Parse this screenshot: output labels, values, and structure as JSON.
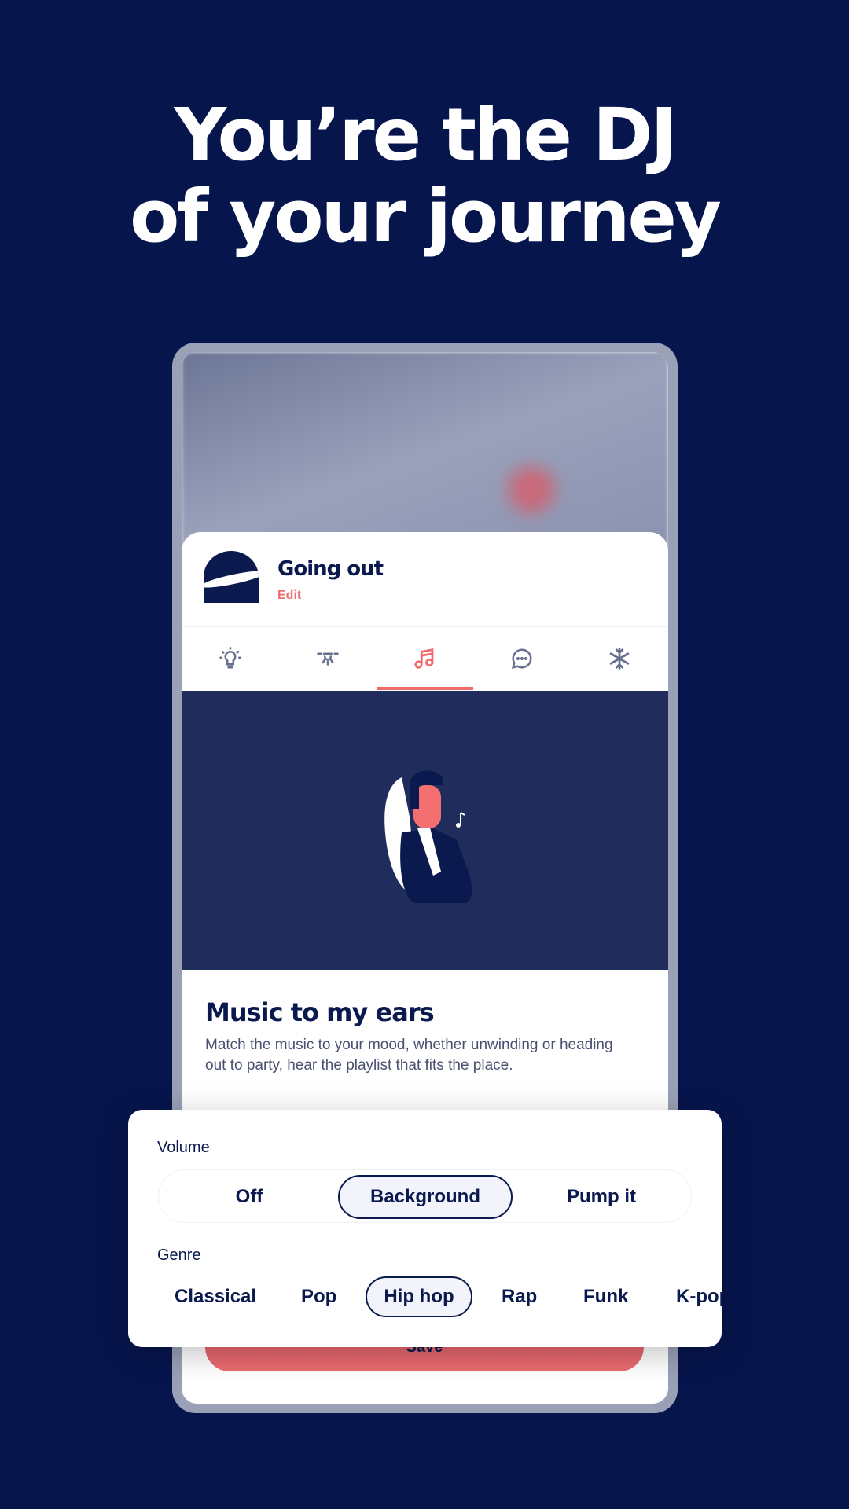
{
  "headline": {
    "line1": "You’re the DJ",
    "line2": "of your journey"
  },
  "profile": {
    "title": "Going out",
    "edit_label": "Edit"
  },
  "tabs": [
    {
      "icon": "lightbulb-icon",
      "active": false
    },
    {
      "icon": "ceiling-light-icon",
      "active": false
    },
    {
      "icon": "music-note-icon",
      "active": true
    },
    {
      "icon": "chat-bubble-icon",
      "active": false
    },
    {
      "icon": "snowflake-icon",
      "active": false
    }
  ],
  "section": {
    "title": "Music to my ears",
    "description": "Match the music to your mood, whether unwinding or heading out to party, hear the playlist that fits the place."
  },
  "save_label": "Save",
  "volume": {
    "label": "Volume",
    "options": [
      "Off",
      "Background",
      "Pump it"
    ],
    "selected": "Background"
  },
  "genre": {
    "label": "Genre",
    "options": [
      "Classical",
      "Pop",
      "Hip hop",
      "Rap",
      "Funk",
      "K-pop"
    ],
    "selected": "Hip hop"
  },
  "colors": {
    "background": "#07154d",
    "accent": "#f06a6a",
    "navy": "#0b1a4e",
    "hero": "#202c5c"
  }
}
